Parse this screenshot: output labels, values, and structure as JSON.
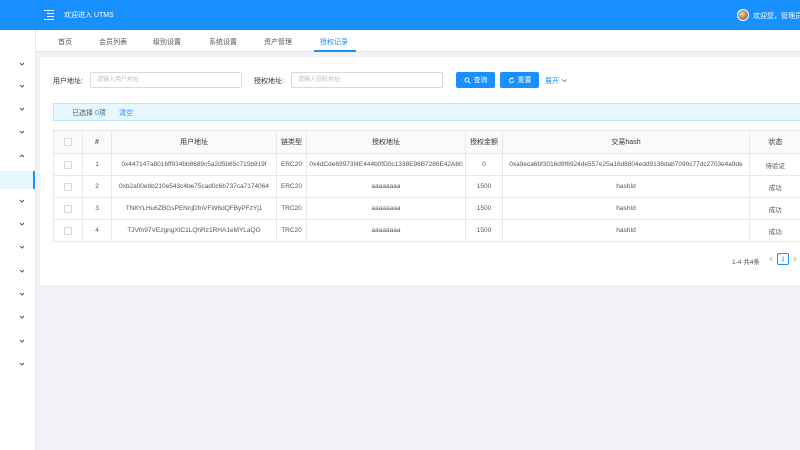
{
  "header": {
    "title": "欢迎进入 UTMS",
    "welcome": "欢迎您，管理员"
  },
  "sidebar": {
    "item_count": 14,
    "active_index": 5
  },
  "tabs": [
    {
      "label": "首页"
    },
    {
      "label": "会员列表"
    },
    {
      "label": "级别设置"
    },
    {
      "label": "系统设置"
    },
    {
      "label": "资产管理"
    },
    {
      "label": "授权记录",
      "active": true
    }
  ],
  "filters": {
    "user_address_label": "用户地址:",
    "user_address_placeholder": "请输入用户地址",
    "auth_address_label": "授权地址:",
    "auth_address_placeholder": "请输入授权地址",
    "query_label": "查询",
    "reset_label": "重置",
    "expand_label": "展开"
  },
  "selection": {
    "prefix": "已选择 ",
    "count": "0",
    "suffix": "项",
    "clear_label": "清空"
  },
  "table": {
    "headers": [
      "",
      "#",
      "用户地址",
      "链类型",
      "授权地址",
      "授权金额",
      "交易hash",
      "状态"
    ],
    "rows": [
      {
        "index": "1",
        "user_address": "0x447147a8016ff934bb8689c5a2d5b65c715b919f",
        "chain": "ERC20",
        "auth_address": "0x4dCde69973f4E444b0fD0c1338E98B7286E42A80",
        "amount": "0",
        "hash": "0xa9eca6bf3016d9f6924de557e25a16d8804edd9136dab7090c77dc2703e4a9de",
        "status": "待验证"
      },
      {
        "index": "2",
        "user_address": "0xb2a00ebb210e543c4be75cad0c6b737ca7174064",
        "chain": "ERC20",
        "auth_address": "aaaaaaaa",
        "amount": "1500",
        "hash": "hashId",
        "status": "成功"
      },
      {
        "index": "3",
        "user_address": "TN8YLHu6ZBGsPENnjDfnVFW6dQFByPFzYj1",
        "chain": "TRC20",
        "auth_address": "aaaaaaaa",
        "amount": "1500",
        "hash": "hashId",
        "status": "成功"
      },
      {
        "index": "4",
        "user_address": "TJVfn97VEzgngXtC1LQhRz1RHA1eMYLaQG",
        "chain": "TRC20",
        "auth_address": "aaaaaaaa",
        "amount": "1500",
        "hash": "hashId",
        "status": "成功"
      }
    ]
  },
  "pagination": {
    "total_text": "1-4 共4条",
    "current_page": "1"
  },
  "colors": {
    "primary": "#1890ff",
    "background": "#f0f2f5"
  }
}
